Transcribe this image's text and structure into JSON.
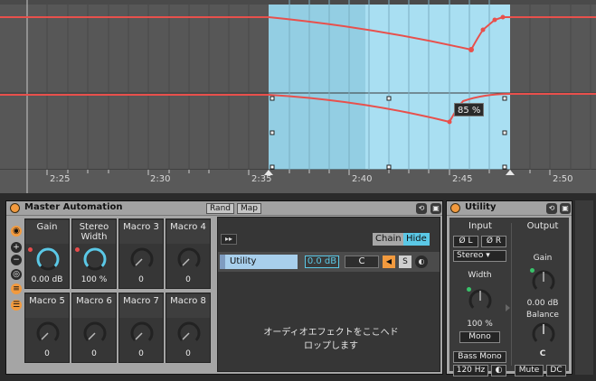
{
  "ruler": {
    "ticks": [
      "2:25",
      "2:30",
      "2:35",
      "2:40",
      "2:45",
      "2:50"
    ]
  },
  "automation": {
    "value_badge": "85 %"
  },
  "colors": {
    "accent": "#5bc8e6",
    "automation_line": "#e8504c",
    "power": "#f29a3e",
    "selection": "#a9dff2"
  },
  "rack": {
    "title": "Master Automation",
    "rand_label": "Rand",
    "map_label": "Map",
    "macros": [
      {
        "label": "Gain",
        "value": "0.00 dB"
      },
      {
        "label": "Stereo Width",
        "value": "100 %"
      },
      {
        "label": "Macro 3",
        "value": "0"
      },
      {
        "label": "Macro 4",
        "value": "0"
      },
      {
        "label": "Macro 5",
        "value": "0"
      },
      {
        "label": "Macro 6",
        "value": "0"
      },
      {
        "label": "Macro 7",
        "value": "0"
      },
      {
        "label": "Macro 8",
        "value": "0"
      }
    ],
    "chain_label": "Chain",
    "hide_label": "Hide",
    "chain": {
      "name": "Utility",
      "volume": "0.0 dB",
      "pan": "C",
      "solo": "S"
    },
    "drop_hint_line1": "オーディオエフェクトをここへド",
    "drop_hint_line2": "ロップします"
  },
  "utility": {
    "title": "Utility",
    "input_label": "Input",
    "output_label": "Output",
    "phase_left": "Ø L",
    "phase_right": "Ø R",
    "mode": "Stereo",
    "width_label": "Width",
    "width_value": "100 %",
    "mono_label": "Mono",
    "bass_mono_label": "Bass Mono",
    "bass_freq": "120 Hz",
    "gain_label": "Gain",
    "gain_value": "0.00 dB",
    "balance_label": "Balance",
    "balance_value": "C",
    "mute_label": "Mute",
    "dc_label": "DC"
  }
}
